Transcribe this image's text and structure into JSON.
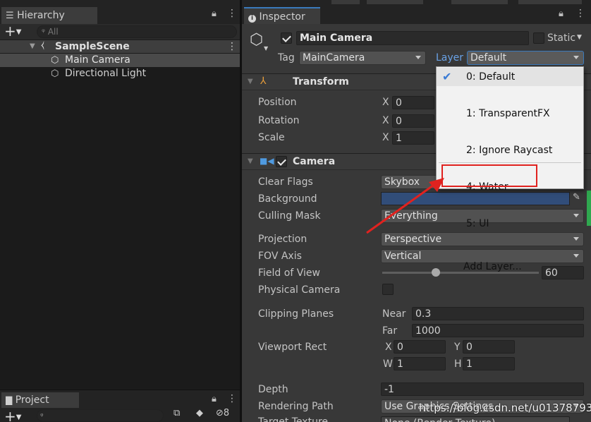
{
  "hierarchy": {
    "tab_label": "Hierarchy",
    "search_placeholder": "All",
    "scene_name": "SampleScene",
    "items": [
      {
        "label": "Main Camera"
      },
      {
        "label": "Directional Light"
      }
    ]
  },
  "project": {
    "tab_label": "Project",
    "hidden_count": "8"
  },
  "inspector": {
    "tab_label": "Inspector",
    "object_name": "Main Camera",
    "static_label": "Static",
    "tag_label": "Tag",
    "tag_value": "MainCamera",
    "layer_label": "Layer",
    "layer_value": "Default",
    "transform": {
      "title": "Transform",
      "rows": [
        {
          "label": "Position",
          "x_label": "X",
          "x_value": "0"
        },
        {
          "label": "Rotation",
          "x_label": "X",
          "x_value": "0"
        },
        {
          "label": "Scale",
          "x_label": "X",
          "x_value": "1"
        }
      ]
    },
    "camera": {
      "title": "Camera",
      "clear_flags_label": "Clear Flags",
      "clear_flags_value": "Skybox",
      "background_label": "Background",
      "background_color": "#314d79",
      "culling_mask_label": "Culling Mask",
      "culling_mask_value": "Everything",
      "projection_label": "Projection",
      "projection_value": "Perspective",
      "fov_axis_label": "FOV Axis",
      "fov_axis_value": "Vertical",
      "fov_label": "Field of View",
      "fov_value": "60",
      "physical_camera_label": "Physical Camera",
      "clipping_label": "Clipping Planes",
      "near_label": "Near",
      "near_value": "0.3",
      "far_label": "Far",
      "far_value": "1000",
      "viewport_label": "Viewport Rect",
      "vp_x_label": "X",
      "vp_x_value": "0",
      "vp_y_label": "Y",
      "vp_y_value": "0",
      "vp_w_label": "W",
      "vp_w_value": "1",
      "vp_h_label": "H",
      "vp_h_value": "1",
      "depth_label": "Depth",
      "depth_value": "-1",
      "rendering_path_label": "Rendering Path",
      "rendering_path_value": "Use Graphics Settings",
      "target_texture_label": "Target Texture",
      "target_texture_value": "None (Render Texture)"
    }
  },
  "layer_menu": {
    "items": [
      {
        "label": "0: Default",
        "checked": true
      },
      {
        "label": "1: TransparentFX"
      },
      {
        "label": "2: Ignore Raycast"
      },
      {
        "label": "4: Water"
      },
      {
        "label": "5: UI"
      }
    ],
    "add_layer_label": "Add Layer..."
  },
  "watermark": "https://blog.csdn.net/u013787931",
  "colors": {
    "highlight_red": "#e0221f",
    "selection": "#4a4a4a",
    "background_swatch": "#314d79"
  }
}
